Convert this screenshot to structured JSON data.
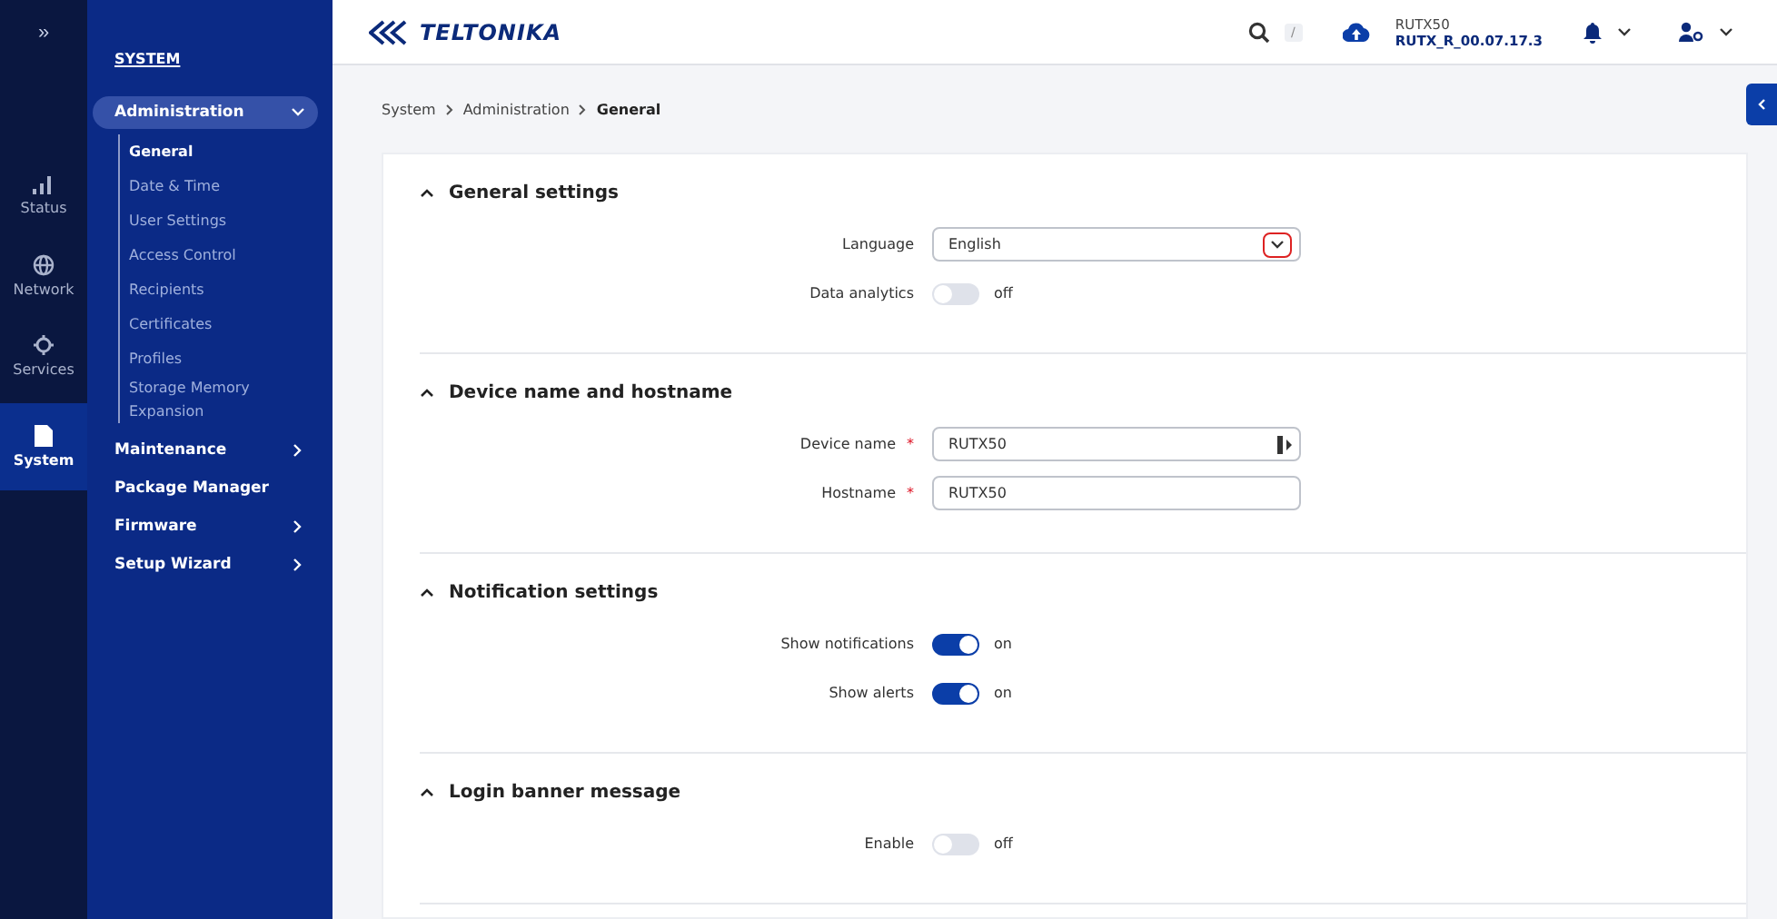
{
  "rail": {
    "toggle": "»",
    "items": [
      {
        "label": "Status",
        "selected": false
      },
      {
        "label": "Network",
        "selected": false
      },
      {
        "label": "Services",
        "selected": false
      },
      {
        "label": "System",
        "selected": true
      }
    ]
  },
  "sidebar": {
    "title": "SYSTEM",
    "groups": [
      {
        "label": "Administration",
        "expanded": true,
        "has_children": true,
        "children": [
          {
            "label": "General",
            "selected": true
          },
          {
            "label": "Date & Time",
            "selected": false
          },
          {
            "label": "User Settings",
            "selected": false
          },
          {
            "label": "Access Control",
            "selected": false
          },
          {
            "label": "Recipients",
            "selected": false
          },
          {
            "label": "Certificates",
            "selected": false
          },
          {
            "label": "Profiles",
            "selected": false
          },
          {
            "label": "Storage Memory Expansion",
            "selected": false
          }
        ]
      },
      {
        "label": "Maintenance",
        "expanded": false,
        "has_children": true
      },
      {
        "label": "Package Manager",
        "expanded": false,
        "has_children": false
      },
      {
        "label": "Firmware",
        "expanded": false,
        "has_children": true
      },
      {
        "label": "Setup Wizard",
        "expanded": false,
        "has_children": true
      }
    ]
  },
  "header": {
    "logo": "TELTONIKA",
    "search_shortcut": "/",
    "device": "RUTX50",
    "firmware": "RUTX_R_00.07.17.3"
  },
  "breadcrumb": [
    "System",
    "Administration",
    "General"
  ],
  "sections": [
    {
      "title": "General settings",
      "expanded": true,
      "rows": [
        {
          "kind": "select",
          "label": "Language",
          "value": "English"
        },
        {
          "kind": "toggle",
          "label": "Data analytics",
          "on": false,
          "state": "off"
        }
      ]
    },
    {
      "title": "Device name and hostname",
      "expanded": true,
      "rows": [
        {
          "kind": "input",
          "label": "Device name",
          "value": "RUTX50",
          "required_mark": "*",
          "copy_icon": true
        },
        {
          "kind": "input",
          "label": "Hostname",
          "value": "RUTX50",
          "required_mark": "*"
        }
      ]
    },
    {
      "title": "Notification settings",
      "expanded": true,
      "rows": [
        {
          "kind": "toggle",
          "label": "Show notifications",
          "on": true,
          "state": "on"
        },
        {
          "kind": "toggle",
          "label": "Show alerts",
          "on": true,
          "state": "on"
        }
      ]
    },
    {
      "title": "Login banner message",
      "expanded": true,
      "rows": [
        {
          "kind": "toggle",
          "label": "Enable",
          "on": false,
          "state": "off"
        }
      ]
    }
  ]
}
